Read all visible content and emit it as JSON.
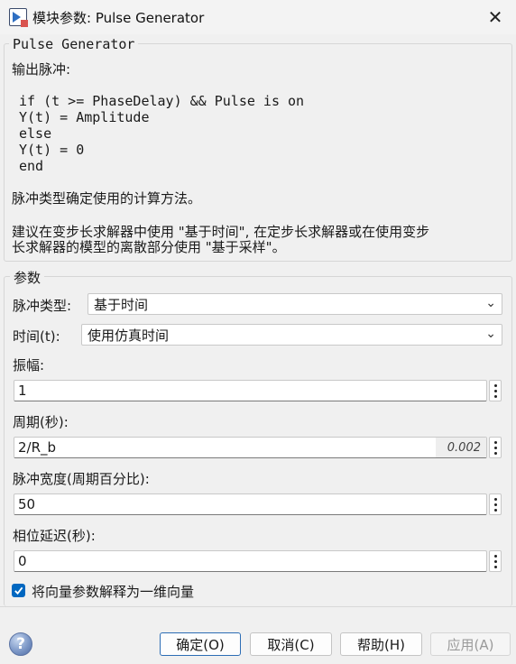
{
  "window": {
    "title": "模块参数: Pulse Generator",
    "close_glyph": "✕"
  },
  "description": {
    "group_title": "Pulse Generator",
    "intro": "输出脉冲:",
    "code_lines": [
      "if (t >= PhaseDelay) && Pulse is on",
      "Y(t) = Amplitude",
      "else",
      "Y(t) = 0",
      "end"
    ],
    "text1": "脉冲类型确定使用的计算方法。",
    "text2_line1": "建议在变步长求解器中使用 \"基于时间\", 在定步长求解器或在使用变步",
    "text2_line2": "长求解器的模型的离散部分使用 \"基于采样\"。"
  },
  "params": {
    "group_title": "参数",
    "pulse_type": {
      "label": "脉冲类型:",
      "value": "基于时间"
    },
    "time": {
      "label": "时间(t):",
      "value": "使用仿真时间"
    },
    "amplitude": {
      "label": "振幅:",
      "value": "1"
    },
    "period": {
      "label": "周期(秒):",
      "value": "2/R_b",
      "evaluated": "0.002"
    },
    "pulse_width": {
      "label": "脉冲宽度(周期百分比):",
      "value": "50"
    },
    "phase_delay": {
      "label": "相位延迟(秒):",
      "value": "0"
    },
    "interpret_vector": {
      "label": "将向量参数解释为一维向量",
      "checked": true
    }
  },
  "buttons": {
    "ok": "确定(O)",
    "cancel": "取消(C)",
    "help": "帮助(H)",
    "apply": "应用(A)",
    "help_icon": "?"
  },
  "icons": {
    "app": "simulink-block-icon",
    "close": "close-icon",
    "dropdown": "chevron-down-icon",
    "more": "kebab-menu-icon"
  },
  "colors": {
    "accent": "#0067c0",
    "primary_border": "#2c6db5"
  }
}
